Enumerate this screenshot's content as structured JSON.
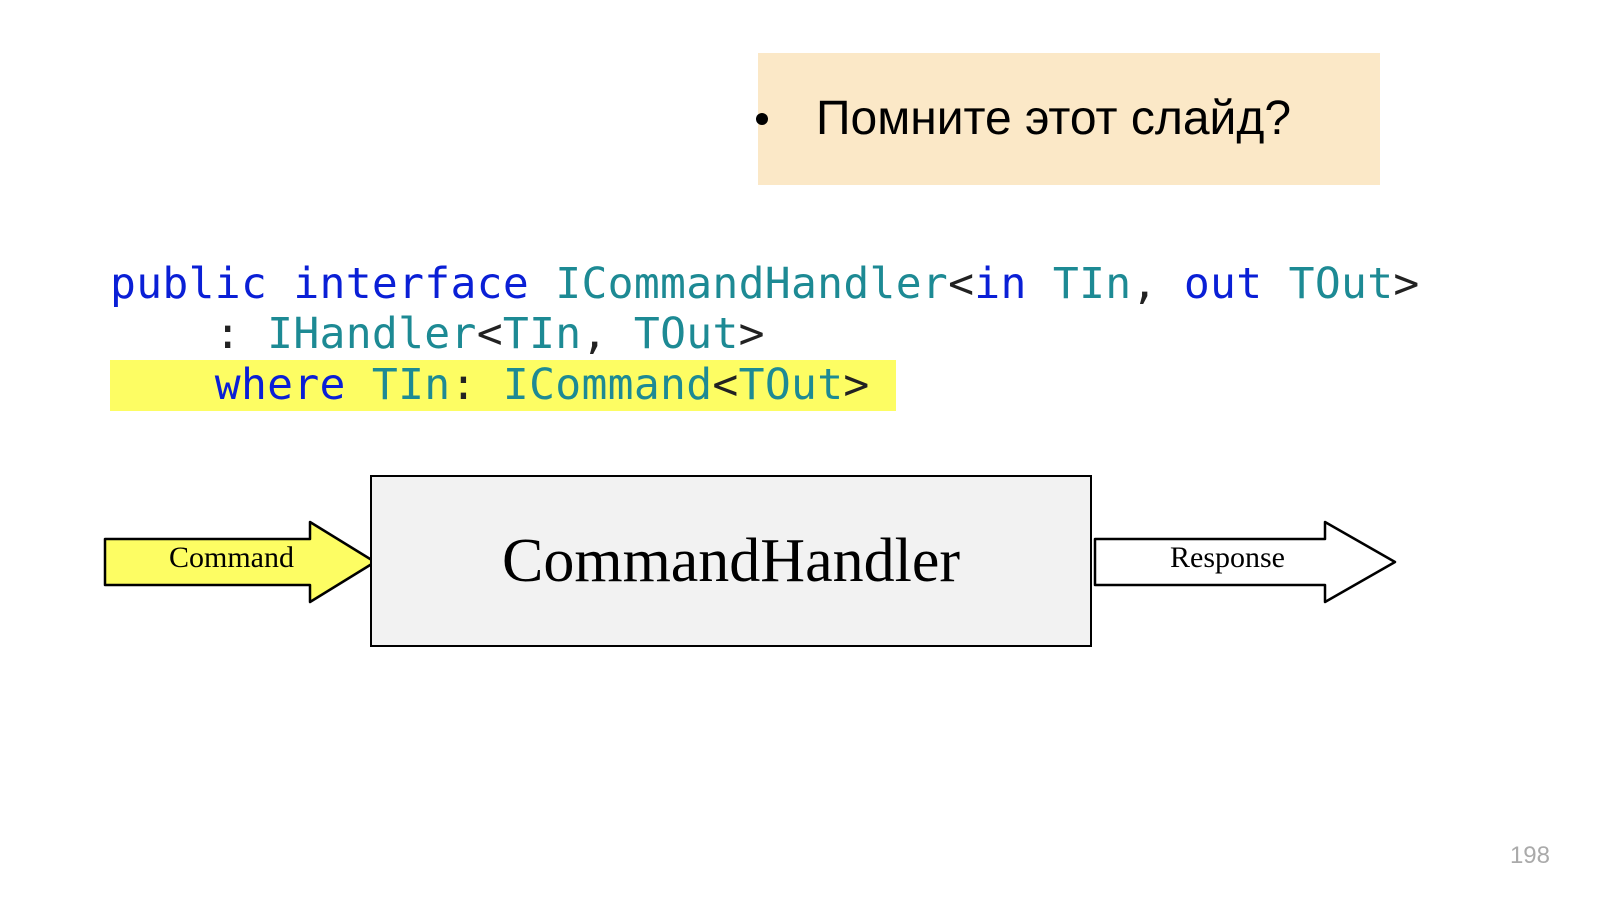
{
  "callout": {
    "text": "Помните этот слайд?"
  },
  "code": {
    "line1": {
      "kw1": "public",
      "kw2": "interface",
      "type1": "ICommandHandler",
      "lt": "<",
      "kw3": "in",
      "type2": "TIn",
      "comma": ",",
      "kw4": "out",
      "type3": "TOut",
      "gt": ">"
    },
    "line2": {
      "colon": ":",
      "type1": "IHandler",
      "lt": "<",
      "type2": "TIn",
      "comma": ",",
      "type3": "TOut",
      "gt": ">"
    },
    "line3": {
      "kw1": "where",
      "type1": "TIn",
      "colon": ":",
      "type2": "ICommand",
      "lt": "<",
      "type3": "TOut",
      "gt": ">"
    }
  },
  "diagram": {
    "left_arrow_label": "Command",
    "box_label": "CommandHandler",
    "right_arrow_label": "Response",
    "colors": {
      "left_arrow_fill": "#fdfd63",
      "right_arrow_fill": "#ffffff",
      "box_fill": "#f2f2f2"
    }
  },
  "page_number": "198"
}
